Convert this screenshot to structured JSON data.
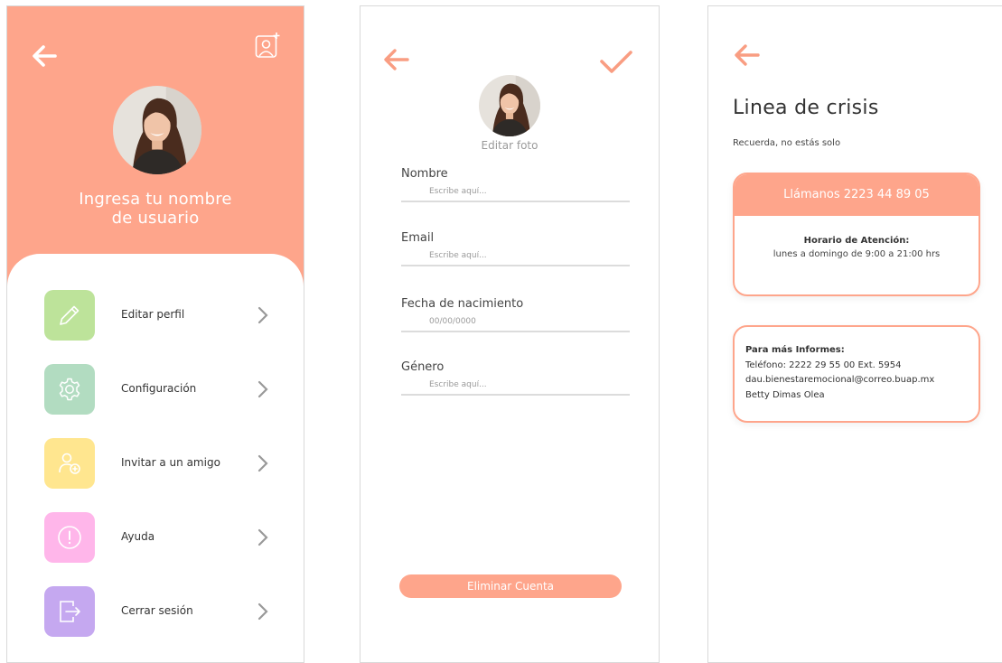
{
  "colors": {
    "accent": "#fea58b",
    "tile_edit": "#bde39a",
    "tile_settings": "#b2dcc1",
    "tile_invite": "#ffe68f",
    "tile_help": "#ffb6ea",
    "tile_logout": "#c5a8f0"
  },
  "profile_menu": {
    "username_prompt": "Ingresa tu nombre\nde usuario",
    "items": [
      {
        "label": "Editar perfil",
        "icon": "pencil-icon"
      },
      {
        "label": "Configuración",
        "icon": "gear-icon"
      },
      {
        "label": "Invitar a  un amigo",
        "icon": "add-friend-icon"
      },
      {
        "label": "Ayuda",
        "icon": "alert-circle-icon"
      },
      {
        "label": "Cerrar sesión",
        "icon": "logout-icon"
      }
    ]
  },
  "edit_profile": {
    "edit_photo_label": "Editar foto",
    "fields": [
      {
        "label": "Nombre",
        "placeholder": "Escribe aquí..."
      },
      {
        "label": "Email",
        "placeholder": "Escribe aquí..."
      },
      {
        "label": "Fecha de nacimiento",
        "placeholder": "00/00/0000"
      },
      {
        "label": "Género",
        "placeholder": "Escribe aquí..."
      }
    ],
    "delete_label": "Eliminar Cuenta"
  },
  "crisis_line": {
    "title": "Linea de crisis",
    "subtitle": "Recuerda, no estás solo",
    "call_label": "Llámanos 2223 44 89 05",
    "hours_title": "Horario de Atención:",
    "hours_value": "lunes a domingo de 9:00 a 21:00 hrs",
    "info_title": "Para más Informes:",
    "info_phone": "Teléfono: 2222 29 55 00 Ext. 5954",
    "info_email": "dau.bienestaremocional@correo.buap.mx",
    "info_contact": "Betty Dimas Olea"
  }
}
